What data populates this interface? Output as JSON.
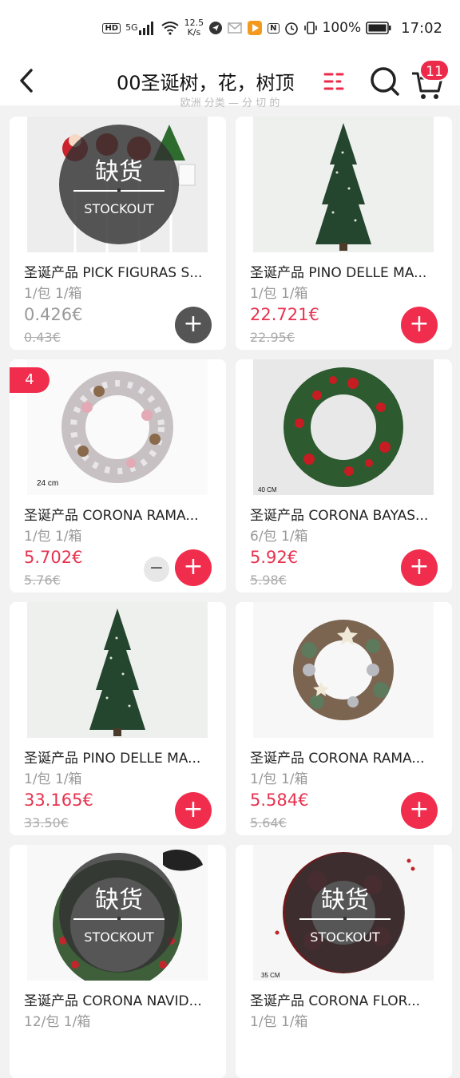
{
  "status_bar": {
    "hd": "HD",
    "net": "5G",
    "speed_top": "12.5",
    "speed_bottom": "K/s",
    "nfc": "N",
    "battery": "100%",
    "time": "17:02"
  },
  "header": {
    "title": "00圣诞树，花，树顶",
    "cart_count": "11",
    "subhint": "欧洲 分类 — 分 切 的"
  },
  "stockout": {
    "cn": "缺货",
    "en": "STOCKOUT"
  },
  "products": [
    {
      "name": "圣诞产品 PICK FIGURAS S...",
      "pack": "1/包 1/箱",
      "price": "0.426€",
      "old": "0.43€",
      "stockout": true,
      "qty": "",
      "img": "pick"
    },
    {
      "name": "圣诞产品 PINO DELLE MA...",
      "pack": "1/包 1/箱",
      "price": "22.721€",
      "old": "22.95€",
      "stockout": false,
      "qty": "",
      "img": "tree"
    },
    {
      "name": "圣诞产品 CORONA RAMA...",
      "pack": "1/包 1/箱",
      "price": "5.702€",
      "old": "5.76€",
      "stockout": false,
      "qty": "4",
      "img": "wreath-white",
      "img_label": "24 cm"
    },
    {
      "name": "圣诞产品 CORONA BAYAS...",
      "pack": "6/包 1/箱",
      "price": "5.92€",
      "old": "5.98€",
      "stockout": false,
      "qty": "",
      "img": "wreath-red",
      "img_label": "40 CM"
    },
    {
      "name": "圣诞产品 PINO DELLE MA...",
      "pack": "1/包 1/箱",
      "price": "33.165€",
      "old": "33.50€",
      "stockout": false,
      "qty": "",
      "img": "tree"
    },
    {
      "name": "圣诞产品 CORONA RAMA...",
      "pack": "1/包 1/箱",
      "price": "5.584€",
      "old": "5.64€",
      "stockout": false,
      "qty": "",
      "img": "wreath-star"
    },
    {
      "name": "圣诞产品 CORONA NAVID...",
      "pack": "12/包 1/箱",
      "price": "",
      "old": "",
      "stockout": true,
      "qty": "",
      "img": "wreath-green"
    },
    {
      "name": "圣诞产品 CORONA FLOR...",
      "pack": "1/包 1/箱",
      "price": "",
      "old": "",
      "stockout": true,
      "qty": "",
      "img": "wreath-flower",
      "img_label": "35 CM"
    }
  ]
}
